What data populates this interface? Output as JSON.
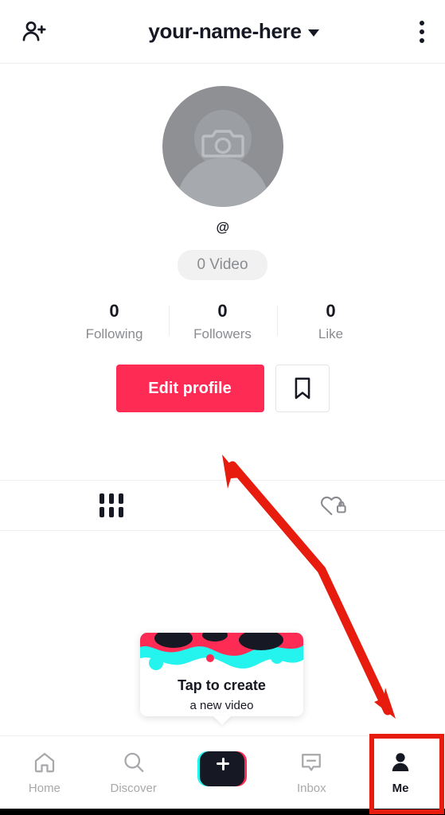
{
  "header": {
    "add_friend_icon": "add-person-icon",
    "title": "your-name-here",
    "caret_icon": "chevron-down-icon",
    "more_icon": "three-dots-vertical-icon"
  },
  "profile": {
    "avatar_icon": "camera-icon",
    "avatar_placeholder": "person-silhouette-icon",
    "handle": "@",
    "video_badge": "0 Video",
    "stats": [
      {
        "value": "0",
        "label": "Following"
      },
      {
        "value": "0",
        "label": "Followers"
      },
      {
        "value": "0",
        "label": "Like"
      }
    ],
    "edit_button": "Edit profile",
    "bookmark_icon": "bookmark-icon"
  },
  "tabs": [
    {
      "name": "posts",
      "icon": "grid-icon",
      "active": true
    },
    {
      "name": "liked-private",
      "icon": "heart-lock-icon",
      "active": false
    }
  ],
  "create_card": {
    "line1": "Tap to create",
    "line2": "a new video"
  },
  "bottom_nav": [
    {
      "label": "Home",
      "icon": "home-icon",
      "active": false
    },
    {
      "label": "Discover",
      "icon": "search-icon",
      "active": false
    },
    {
      "label": "",
      "icon": "create-plus-icon",
      "active": false
    },
    {
      "label": "Inbox",
      "icon": "message-icon",
      "active": false
    },
    {
      "label": "Me",
      "icon": "person-icon",
      "active": true
    }
  ],
  "annotations": {
    "arrow": "red-double-headed-arrow",
    "highlight_box": "red-rectangle-around-me-tab"
  },
  "colors": {
    "accent_red": "#fe2c55",
    "accent_cyan": "#25f4ee",
    "dark": "#161823",
    "muted": "#8a8b91",
    "annotation_red": "#e81b0f"
  }
}
